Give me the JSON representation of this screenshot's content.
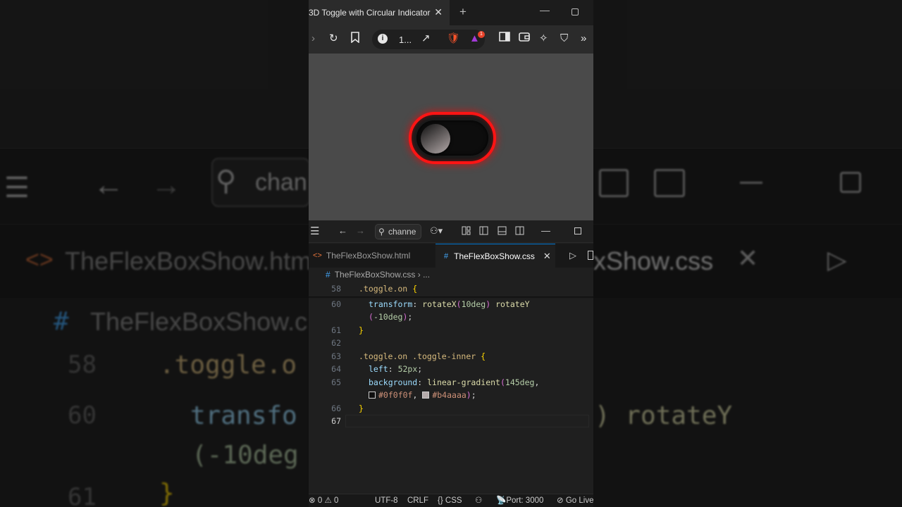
{
  "browser": {
    "tab_title": "3D Toggle with Circular Indicator",
    "tab_close": "✕",
    "new_tab": "+",
    "address_text": "1...",
    "notification_count": "1"
  },
  "vscode": {
    "search_text": "channe",
    "tabs": [
      {
        "label": "TheFlexBoxShow.html"
      },
      {
        "label": "TheFlexBoxShow.css"
      }
    ],
    "breadcrumb": {
      "file": "TheFlexBoxShow.css",
      "more": "..."
    },
    "lines": {
      "58": "58",
      "60": "60",
      "61": "61",
      "62": "62",
      "63": "63",
      "64": "64",
      "65": "65",
      "66": "66",
      "67": "67"
    },
    "code": {
      "l58_selector": ".toggle.on",
      "l60_prop": "transform",
      "l60_fn1": "rotateX",
      "l60_num1": "10deg",
      "l60_fn2": "rotateY",
      "l60b_num": "-10deg",
      "l63_selector": ".toggle.on .toggle-inner",
      "l64_prop": "left",
      "l64_val": "52px",
      "l65_prop": "background",
      "l65_fn": "linear-gradient",
      "l65_num": "145deg",
      "color1": "#0f0f0f",
      "color2": "#b4aaaa"
    },
    "status": {
      "errors": "0",
      "warnings": "0",
      "encoding": "UTF-8",
      "eol": "CRLF",
      "language": "CSS",
      "port": "Port: 3000",
      "golive": "Go Live"
    }
  },
  "background_zoom": {
    "search": "chan",
    "tab_html": "TheFlexBoxShow.htm",
    "tab_css": "xShow.css",
    "breadcrumb": "TheFlexBoxShow.c",
    "line58": "58",
    "code58": ".toggle.o",
    "line60": "60",
    "code60": "transfo",
    "code60_right": ") rotateY",
    "code60b": "(-10deg",
    "line61": "61",
    "code61": "}"
  },
  "colors": {
    "toggle_ring": "#ff1414",
    "accent": "#0078d4"
  }
}
